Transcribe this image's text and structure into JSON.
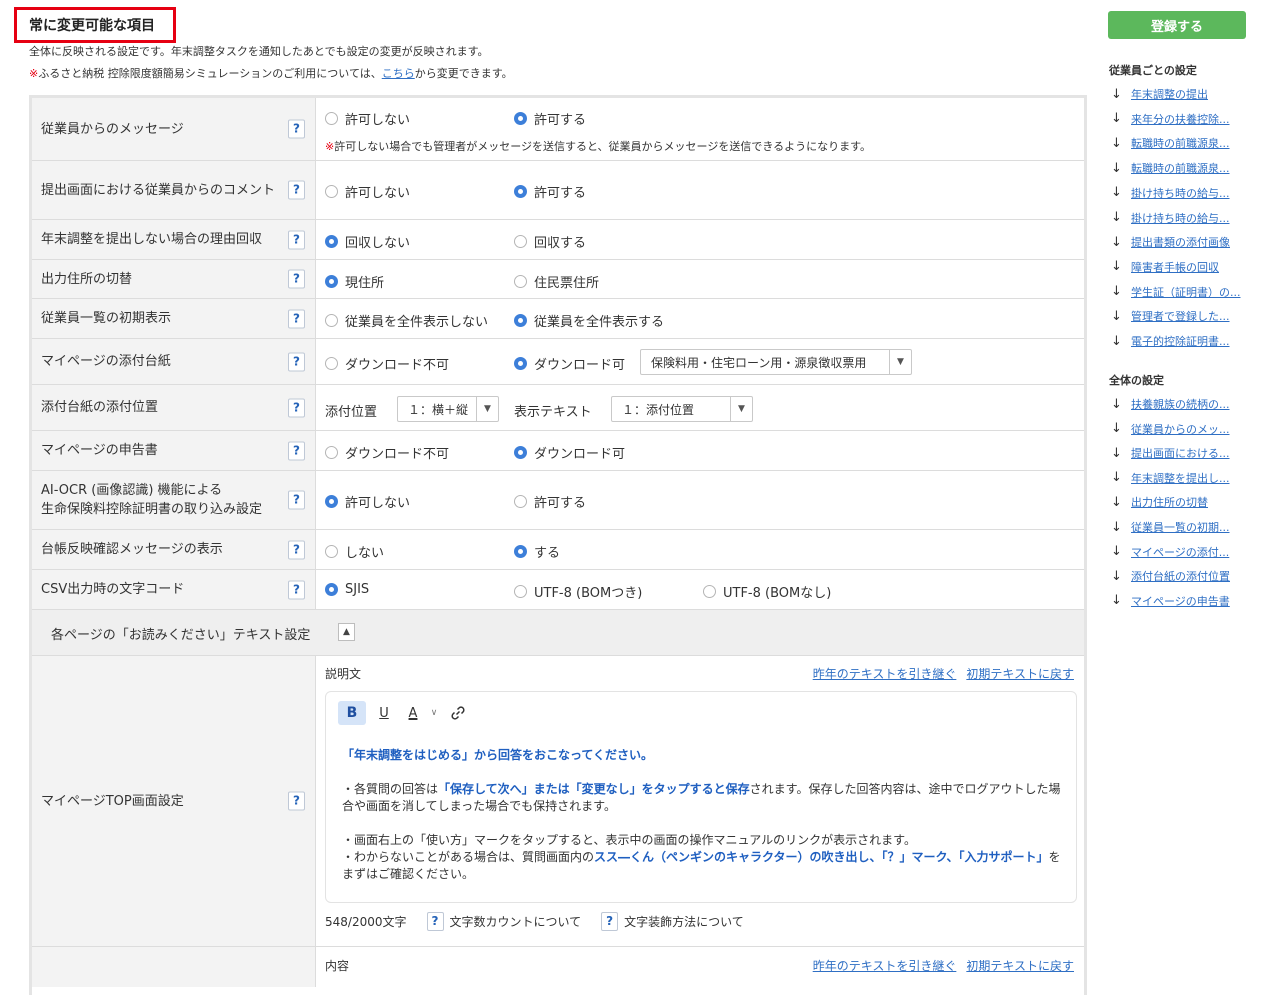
{
  "header": {
    "title": "常に変更可能な項目",
    "desc1": "全体に反映される設定です。年末調整タスクを通知したあとでも設定の変更が反映されます。",
    "desc2_mark": "※",
    "desc2_before": "ふるさと納税 控除限度額簡易シミュレーションのご利用については、",
    "desc2_link": "こちら",
    "desc2_after": "から変更できます。"
  },
  "help_glyph": "?",
  "rows": {
    "r0": {
      "label": "従業員からのメッセージ",
      "opt1": "許可しない",
      "opt2": "許可する",
      "note_mark": "※",
      "note": "許可しない場合でも管理者がメッセージを送信すると、従業員からメッセージを送信できるようになります。"
    },
    "r1": {
      "label": "提出画面における従業員からのコメント",
      "opt1": "許可しない",
      "opt2": "許可する"
    },
    "r2": {
      "label": "年末調整を提出しない場合の理由回収",
      "opt1": "回収しない",
      "opt2": "回収する"
    },
    "r3": {
      "label": "出力住所の切替",
      "opt1": "現住所",
      "opt2": "住民票住所"
    },
    "r4": {
      "label": "従業員一覧の初期表示",
      "opt1": "従業員を全件表示しない",
      "opt2": "従業員を全件表示する"
    },
    "r5": {
      "label": "マイページの添付台紙",
      "opt1": "ダウンロード不可",
      "opt2": "ダウンロード可",
      "select": "保険料用・住宅ローン用・源泉徴収票用"
    },
    "r6": {
      "label": "添付台紙の添付位置",
      "pos_label": "添付位置",
      "pos_value": "１：横＋縦",
      "text_label": "表示テキスト",
      "text_value": "１：添付位置"
    },
    "r7": {
      "label": "マイページの申告書",
      "opt1": "ダウンロード不可",
      "opt2": "ダウンロード可"
    },
    "r8": {
      "label1": "AI-OCR (画像認識) 機能による",
      "label2": "生命保険料控除証明書の取り込み設定",
      "opt1": "許可しない",
      "opt2": "許可する"
    },
    "r9": {
      "label": "台帳反映確認メッセージの表示",
      "opt1": "しない",
      "opt2": "する"
    },
    "r10": {
      "label": "CSV出力時の文字コード",
      "opt1": "SJIS",
      "opt2": "UTF-8 (BOMつき)",
      "opt3": "UTF-8 (BOMなし)"
    }
  },
  "section": {
    "title": "各ページの「お読みください」テキスト設定",
    "collapse_glyph": "▲"
  },
  "mypage_top": {
    "label": "マイページTOP画面設定",
    "editor_label": "説明文",
    "link_inherit": "昨年のテキストを引き継ぐ",
    "link_reset": "初期テキストに戻す",
    "toolbar": {
      "bold": "B",
      "underline": "U",
      "color": "A",
      "caret": "∨"
    },
    "content": {
      "p1": "「年末調整をはじめる」から回答をおこなってください。",
      "p2_a": "・各質問の回答は",
      "p2_b": "「保存して次へ」または「変更なし」をタップすると保存",
      "p2_c": "されます。保存した回答内容は、途中でログアウトした場合や画面を消してしまった場合でも保持されます。",
      "p3": "・画面右上の「使い方」マークをタップすると、表示中の画面の操作マニュアルのリンクが表示されます。",
      "p4_a": "・わからないことがある場合は、質問画面内の",
      "p4_b": "スス―くん（ペンギンのキャラクター）の吹き出し、「？」マーク、「入力サポート」",
      "p4_c": "をまずはご確認ください。"
    },
    "count": "548/2000文字",
    "help_count": "文字数カウントについて",
    "help_format": "文字装飾方法について"
  },
  "next_row": {
    "editor_label": "内容",
    "link_inherit": "昨年のテキストを引き継ぐ",
    "link_reset": "初期テキストに戻す"
  },
  "sidebar": {
    "submit": "登録する",
    "section1": "従業員ごとの設定",
    "items1": [
      "年末調整の提出",
      "来年分の扶養控除...",
      "転職時の前職源泉...",
      "転職時の前職源泉...",
      "掛け持ち時の給与...",
      "掛け持ち時の給与...",
      "提出書類の添付画像",
      "障害者手帳の回収",
      "学生証（証明書）の...",
      "管理者で登録した...",
      "電子的控除証明書..."
    ],
    "section2": "全体の設定",
    "items2": [
      "扶養親族の続柄の...",
      "従業員からのメッ...",
      "提出画面における...",
      "年末調整を提出し...",
      "出力住所の切替",
      "従業員一覧の初期...",
      "マイページの添付...",
      "添付台紙の添付位置",
      "マイページの申告書"
    ],
    "arrow": "↓"
  },
  "colors": {
    "accent_blue": "#3d7fd9",
    "link": "#2f6fc4",
    "red": "#e60012",
    "submit_green": "#5cb85c"
  }
}
